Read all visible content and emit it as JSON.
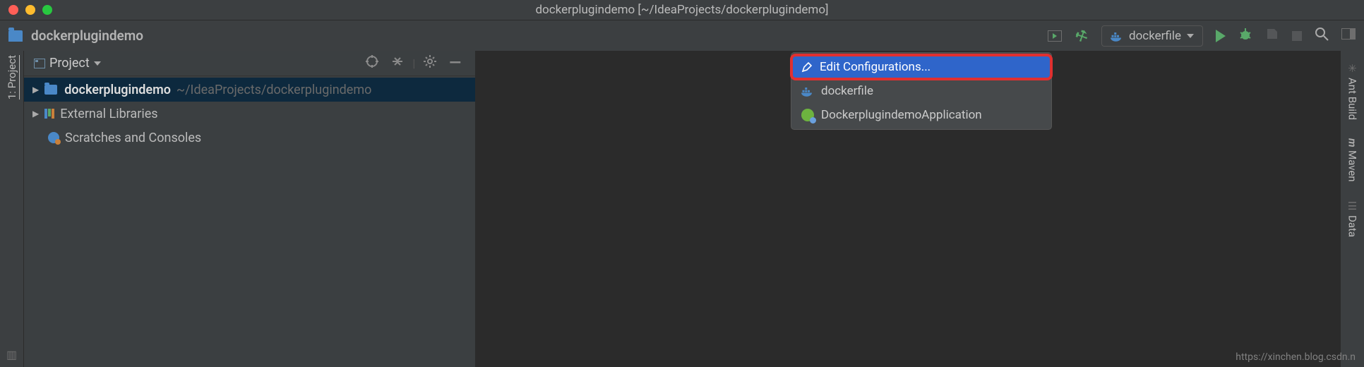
{
  "window": {
    "title": "dockerplugindemo [~/IdeaProjects/dockerplugindemo]"
  },
  "navbar": {
    "project_name": "dockerplugindemo",
    "run_config_selected": "dockerfile"
  },
  "left_tool": {
    "project_label": "1: Project"
  },
  "right_tools": {
    "ant_label": "Ant Build",
    "maven_label": "Maven",
    "database_label": "Data"
  },
  "project_panel": {
    "title": "Project",
    "tree": {
      "root_name": "dockerplugindemo",
      "root_path": "~/IdeaProjects/dockerplugindemo",
      "external_libraries": "External Libraries",
      "scratches": "Scratches and Consoles"
    }
  },
  "run_dropdown": {
    "edit_label": "Edit Configurations...",
    "item_docker": "dockerfile",
    "item_spring": "DockerplugindemoApplication"
  },
  "watermark": "https://xinchen.blog.csdn.n"
}
